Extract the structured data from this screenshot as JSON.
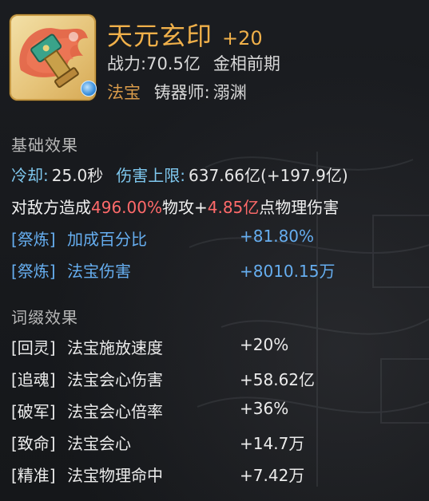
{
  "item": {
    "name": "天元玄印",
    "level": "+20",
    "power_label": "战力:",
    "power_value": "70.5亿",
    "stage": "金相前期",
    "type": "法宝",
    "maker_label": "铸器师:",
    "maker_name": "溺渊",
    "icon": "artifact-seal-icon",
    "badge_icon": "blue-orb-badge-icon"
  },
  "base": {
    "title": "基础效果",
    "cooldown_label": "冷却:",
    "cooldown_value": "25.0秒",
    "cap_label": "伤害上限:",
    "cap_value": "637.66亿(+197.9亿)",
    "damage": {
      "prefix": "对敌方造成",
      "pct": "496.00%",
      "mid": "物攻+",
      "flat": "4.85亿",
      "suffix": "点物理伤害"
    },
    "refine": [
      {
        "tag": "[祭炼]",
        "name": "加成百分比",
        "value": "+81.80%"
      },
      {
        "tag": "[祭炼]",
        "name": "法宝伤害",
        "value": "+8010.15万"
      }
    ]
  },
  "affix": {
    "title": "词缀效果",
    "items": [
      {
        "tag": "[回灵]",
        "name": "法宝施放速度",
        "value": "+20%"
      },
      {
        "tag": "[追魂]",
        "name": "法宝会心伤害",
        "value": "+58.62亿"
      },
      {
        "tag": "[破军]",
        "name": "法宝会心倍率",
        "value": "+36%"
      },
      {
        "tag": "[致命]",
        "name": "法宝会心",
        "value": "+14.7万"
      },
      {
        "tag": "[精准]",
        "name": "法宝物理命中",
        "value": "+7.42万"
      }
    ]
  },
  "colors": {
    "gold": "#f0b04a",
    "orange": "#d79a4a",
    "cyan": "#7fc8ef",
    "blue": "#66aef0",
    "red": "#ff6a6a"
  }
}
